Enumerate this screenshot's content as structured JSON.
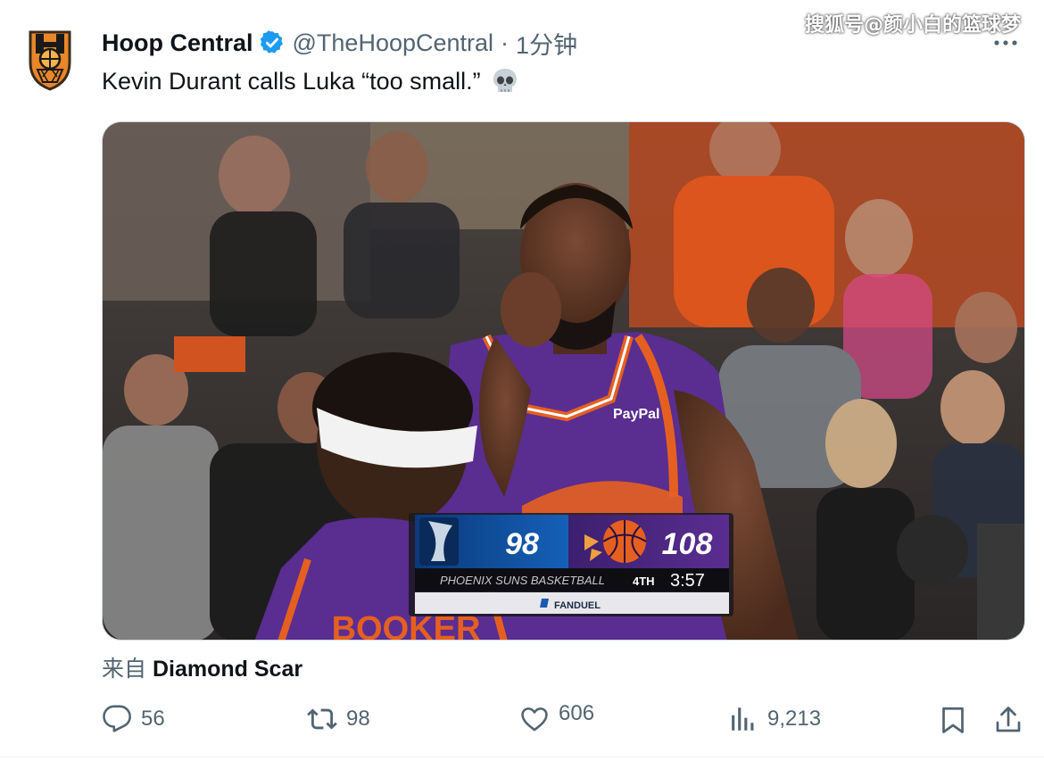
{
  "watermark": "搜狐号@颜小白的篮球梦",
  "author": {
    "name": "Hoop Central",
    "handle": "@TheHoopCentral",
    "separator": "·",
    "time": "1分钟",
    "verified_icon": "verified-badge-icon"
  },
  "tweet": {
    "text": "Kevin Durant calls Luka “too small.”"
  },
  "media": {
    "scorebug": {
      "away_score": "98",
      "home_score": "108",
      "broadcast": "PHOENIX SUNS BASKETBALL",
      "period": "4TH",
      "clock": "3:57",
      "sponsor": "FANDUEL",
      "jersey_sponsor": "PayPal",
      "jersey_back": "BOOKER"
    }
  },
  "source": {
    "prefix": "来自",
    "name": "Diamond Scar"
  },
  "actions": {
    "replies": "56",
    "reposts": "98",
    "likes": "606",
    "views": "9,213"
  },
  "colors": {
    "accent": "#1d9bf0",
    "secondary_text": "#536471",
    "suns_purple": "#5a2d91",
    "suns_orange": "#e56020"
  }
}
